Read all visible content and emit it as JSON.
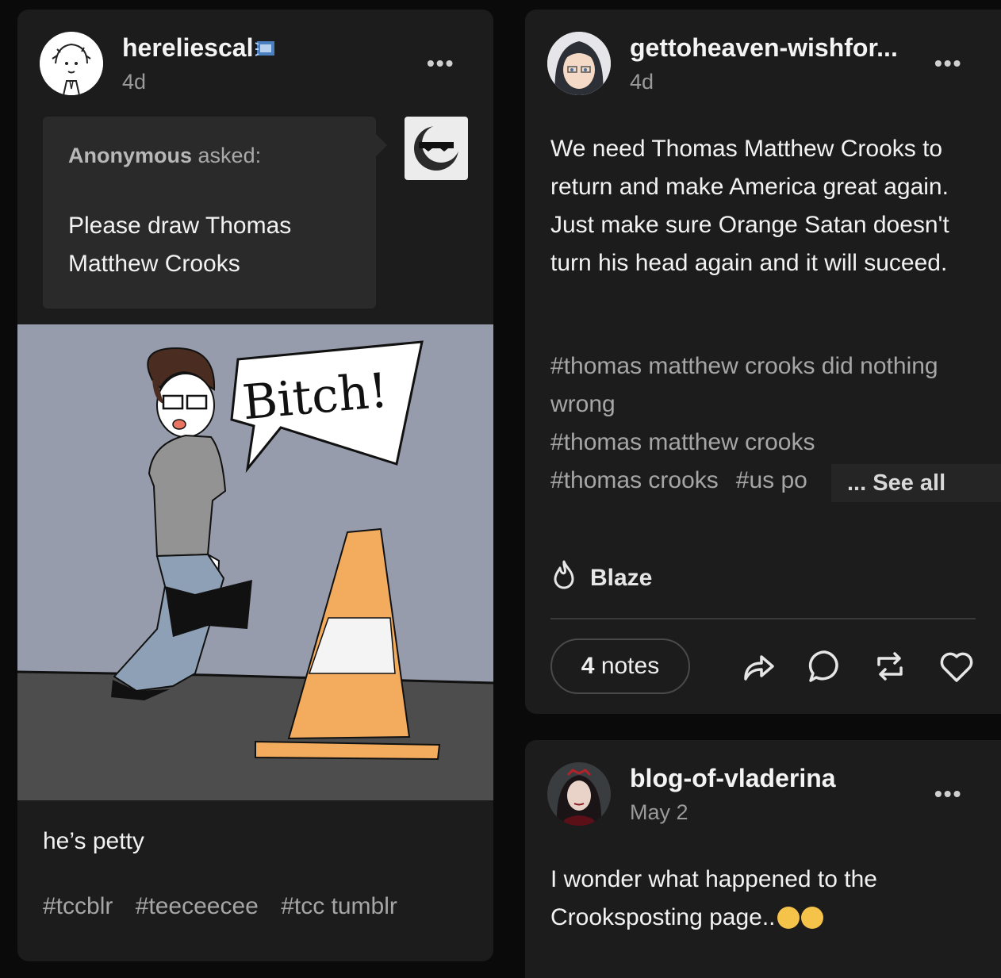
{
  "post1": {
    "username": "hereliescal",
    "time": "4d",
    "more": "•••",
    "ask": {
      "asker": "Anonymous",
      "asked": "asked:",
      "question": "Please draw Thomas Matthew Crooks"
    },
    "illustration_text": "Bitch!",
    "caption": "he’s petty",
    "tags": [
      "#tccblr",
      "#teeceecee",
      "#tcc tumblr"
    ]
  },
  "post2": {
    "username": "gettoheaven-wishfor...",
    "time": "4d",
    "more": "•••",
    "body": "We need Thomas Matthew Crooks to return and make America great again. Just make sure Orange Satan doesn't turn his head again and it will suceed.",
    "tags": [
      "#thomas matthew crooks did nothing wrong",
      "#thomas matthew crooks",
      "#thomas crooks",
      "#us po"
    ],
    "see_all": "... See all",
    "blaze_label": "Blaze",
    "notes_count": "4",
    "notes_label": "notes"
  },
  "post3": {
    "username": "blog-of-vladerina",
    "time": "May 2",
    "more": "•••",
    "body": "I wonder what happened to the Crooksposting page.."
  },
  "colors": {
    "background": "#0a0a0a",
    "card": "#1c1c1c",
    "ask_box": "#2a2a2a",
    "muted_text": "#9a9a9a",
    "cone_orange": "#f3ac5d",
    "scene_wall": "#979cac",
    "scene_floor": "#4d4d4d"
  }
}
